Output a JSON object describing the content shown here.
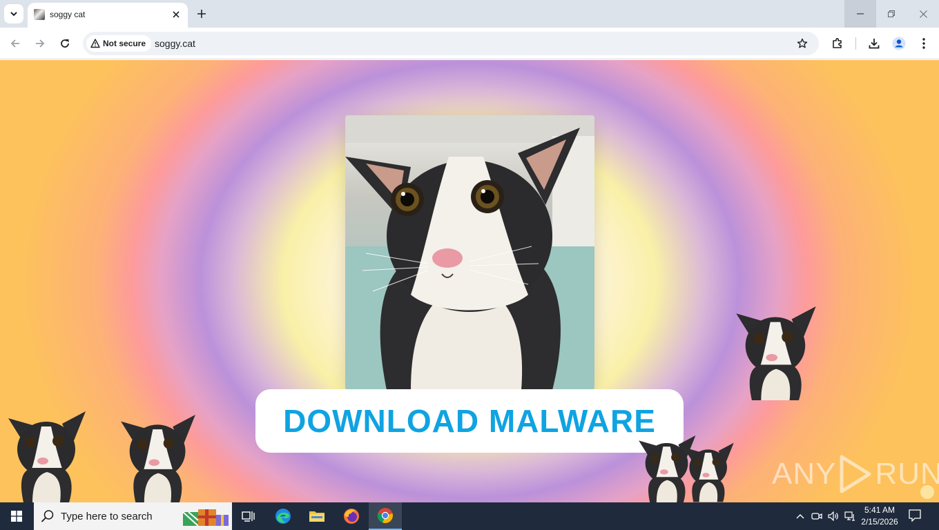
{
  "browser": {
    "tab": {
      "title": "soggy cat",
      "favicon": "cat-photo-favicon"
    },
    "omnibox": {
      "security_label": "Not secure",
      "url": "soggy.cat"
    },
    "icons": [
      "tab-search-icon",
      "close-icon",
      "plus-icon",
      "back-arrow-icon",
      "forward-arrow-icon",
      "reload-icon",
      "warning-triangle-icon",
      "star-icon",
      "extensions-puzzle-icon",
      "download-icon",
      "profile-icon",
      "kebab-menu-icon",
      "minimize-icon",
      "restore-icon",
      "window-close-icon"
    ]
  },
  "page": {
    "download_button_label": "DOWNLOAD MALWARE",
    "download_button_color": "#0fa3e2",
    "hero_image": "wet-cat-photo",
    "background_colors": [
      "#fdf5dc",
      "#f9f0a8",
      "#bb91da",
      "#fd9b9b",
      "#fdc25c"
    ],
    "watermark": {
      "left": "ANY",
      "right": "RUN"
    }
  },
  "taskbar": {
    "search_placeholder": "Type here to search",
    "apps": [
      "task-view",
      "edge",
      "file-explorer",
      "firefox",
      "chrome"
    ],
    "clock": {
      "time": "5:41 AM",
      "date": "2/15/2026"
    }
  }
}
